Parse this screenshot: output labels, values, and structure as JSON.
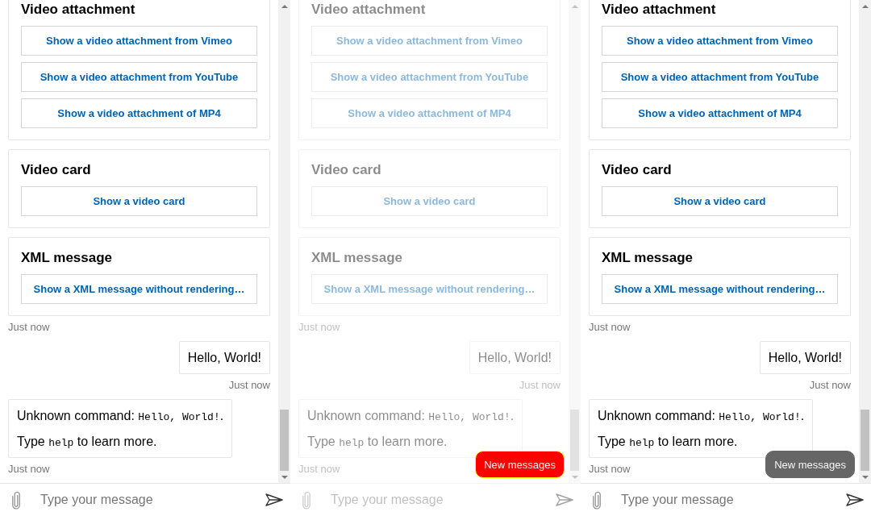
{
  "panels": [
    {
      "dimmed": false,
      "activities": [
        {
          "kind": "cards",
          "cards": [
            {
              "title": "Video attachment",
              "actions": [
                "Show a video attachment from Vimeo",
                "Show a video attachment from YouTube",
                "Show a video attachment of MP4"
              ]
            },
            {
              "title": "Video card",
              "actions": [
                "Show a video card"
              ]
            },
            {
              "title": "XML message",
              "actions": [
                "Show a XML message without rendering…"
              ]
            }
          ],
          "timestamp": "Just now"
        },
        {
          "kind": "user_text",
          "text": "Hello, World!",
          "timestamp": "Just now"
        },
        {
          "kind": "bot_text",
          "paragraphs": [
            [
              {
                "kind": "plain",
                "text": "Unknown command: "
              },
              {
                "kind": "code",
                "text": "Hello, World!"
              },
              {
                "kind": "plain",
                "text": "."
              }
            ],
            [
              {
                "kind": "plain",
                "text": "Type "
              },
              {
                "kind": "code",
                "text": "help"
              },
              {
                "kind": "plain",
                "text": " to learn more."
              }
            ]
          ],
          "timestamp": "Just now"
        }
      ],
      "composer": {
        "placeholder": "Type your message"
      }
    },
    {
      "dimmed": true,
      "activities": [
        {
          "kind": "cards",
          "cards": [
            {
              "title": "Video attachment",
              "actions": [
                "Show a video attachment from Vimeo",
                "Show a video attachment from YouTube",
                "Show a video attachment of MP4"
              ]
            },
            {
              "title": "Video card",
              "actions": [
                "Show a video card"
              ]
            },
            {
              "title": "XML message",
              "actions": [
                "Show a XML message without rendering…"
              ]
            }
          ],
          "timestamp": "Just now"
        },
        {
          "kind": "user_text",
          "text": "Hello, World!",
          "timestamp": "Just now"
        },
        {
          "kind": "bot_text",
          "paragraphs": [
            [
              {
                "kind": "plain",
                "text": "Unknown command: "
              },
              {
                "kind": "code",
                "text": "Hello, World!"
              },
              {
                "kind": "plain",
                "text": "."
              }
            ],
            [
              {
                "kind": "plain",
                "text": "Type "
              },
              {
                "kind": "code",
                "text": "help"
              },
              {
                "kind": "plain",
                "text": " to learn more."
              }
            ]
          ],
          "timestamp": "Just now"
        }
      ],
      "composer": {
        "placeholder": "Type your message"
      },
      "new_messages": {
        "label": "New messages",
        "highlighted": true
      }
    },
    {
      "dimmed": false,
      "activities": [
        {
          "kind": "cards",
          "cards": [
            {
              "title": "Video attachment",
              "actions": [
                "Show a video attachment from Vimeo",
                "Show a video attachment from YouTube",
                "Show a video attachment of MP4"
              ]
            },
            {
              "title": "Video card",
              "actions": [
                "Show a video card"
              ]
            },
            {
              "title": "XML message",
              "actions": [
                "Show a XML message without rendering…"
              ]
            }
          ],
          "timestamp": "Just now"
        },
        {
          "kind": "user_text",
          "text": "Hello, World!",
          "timestamp": "Just now"
        },
        {
          "kind": "bot_text",
          "paragraphs": [
            [
              {
                "kind": "plain",
                "text": "Unknown command: "
              },
              {
                "kind": "code",
                "text": "Hello, World!"
              },
              {
                "kind": "plain",
                "text": "."
              }
            ],
            [
              {
                "kind": "plain",
                "text": "Type "
              },
              {
                "kind": "code",
                "text": "help"
              },
              {
                "kind": "plain",
                "text": " to learn more."
              }
            ]
          ],
          "timestamp": "Just now"
        }
      ],
      "composer": {
        "placeholder": "Type your message"
      },
      "new_messages": {
        "label": "New messages",
        "highlighted": false
      }
    }
  ]
}
